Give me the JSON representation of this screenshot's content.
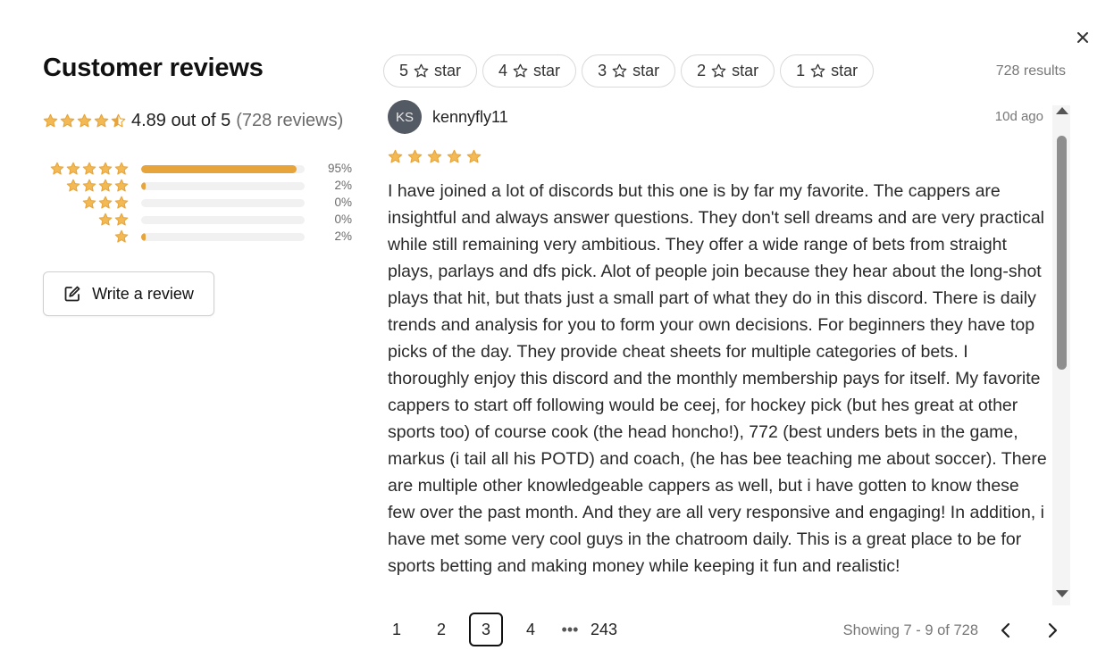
{
  "modal": {
    "title": "Customer reviews",
    "close_icon": "close-icon"
  },
  "summary": {
    "rating_text": "4.89 out of 5",
    "reviews_count": "(728 reviews)",
    "average_rating": 4.89,
    "star_color": "#e6a43a"
  },
  "distribution": [
    {
      "stars": 5,
      "percent_label": "95%",
      "fraction": 0.95
    },
    {
      "stars": 4,
      "percent_label": "2%",
      "fraction": 0.02
    },
    {
      "stars": 3,
      "percent_label": "0%",
      "fraction": 0.0
    },
    {
      "stars": 2,
      "percent_label": "0%",
      "fraction": 0.0
    },
    {
      "stars": 1,
      "percent_label": "2%",
      "fraction": 0.02
    }
  ],
  "write_review": {
    "label": "Write a review",
    "icon": "edit-icon"
  },
  "filters": [
    {
      "num": "5",
      "label": "star"
    },
    {
      "num": "4",
      "label": "star"
    },
    {
      "num": "3",
      "label": "star"
    },
    {
      "num": "2",
      "label": "star"
    },
    {
      "num": "1",
      "label": "star"
    }
  ],
  "results_text": "728 results",
  "review": {
    "initials": "KS",
    "username": "kennyfly11",
    "date": "10d ago",
    "rating": 5,
    "body": "I have joined a lot of discords but this one is by far my favorite. The cappers are insightful and always answer questions. They don't sell dreams and are very practical while still remaining very ambitious. They offer a wide range of bets from straight plays, parlays and dfs pick. Alot of people join because they hear about the long-shot plays that hit, but thats just a small part of what they do in this discord. There is daily trends and analysis for you to form your own decisions. For beginners they have top picks of the day. They provide cheat sheets for multiple categories of bets. I thoroughly enjoy this discord and the monthly membership pays for itself. My favorite cappers to start off following would be ceej, for hockey pick (but hes great at other sports too) of course cook (the head honcho!), 772 (best unders bets in the game, markus (i tail all his POTD) and coach, (he has bee teaching me about soccer). There are multiple other knowledgeable cappers as well, but i have gotten to know these few over the past month. And they are all very responsive and engaging! In addition, i have met some very cool guys in the chatroom daily. This is a great place to be for sports betting and making money while keeping it fun and realistic!"
  },
  "pagination": {
    "pages": [
      "1",
      "2",
      "3",
      "4"
    ],
    "active_page": "3",
    "ellipsis": "•••",
    "last_page": "243",
    "showing": "Showing 7 - 9 of 728"
  }
}
